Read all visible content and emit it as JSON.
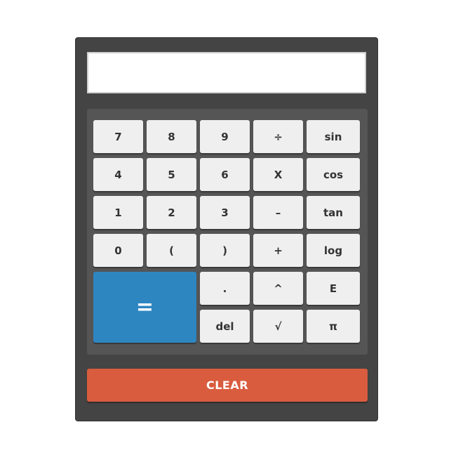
{
  "display": {
    "value": ""
  },
  "keys": {
    "seven": "7",
    "eight": "8",
    "nine": "9",
    "divide": "÷",
    "sin": "sin",
    "four": "4",
    "five": "5",
    "six": "6",
    "multiply": "X",
    "cos": "cos",
    "one": "1",
    "two": "2",
    "three": "3",
    "minus": "–",
    "tan": "tan",
    "zero": "0",
    "open_paren": "(",
    "close_paren": ")",
    "plus": "+",
    "log": "log",
    "equals": "=",
    "decimal": ".",
    "power": "^",
    "exp": "E",
    "del": "del",
    "sqrt": "√",
    "pi": "π"
  },
  "clear_label": "CLEAR",
  "colors": {
    "body": "#444444",
    "keypad": "#555555",
    "key": "#efefef",
    "equals": "#2e86c1",
    "clear": "#d95c3e"
  }
}
